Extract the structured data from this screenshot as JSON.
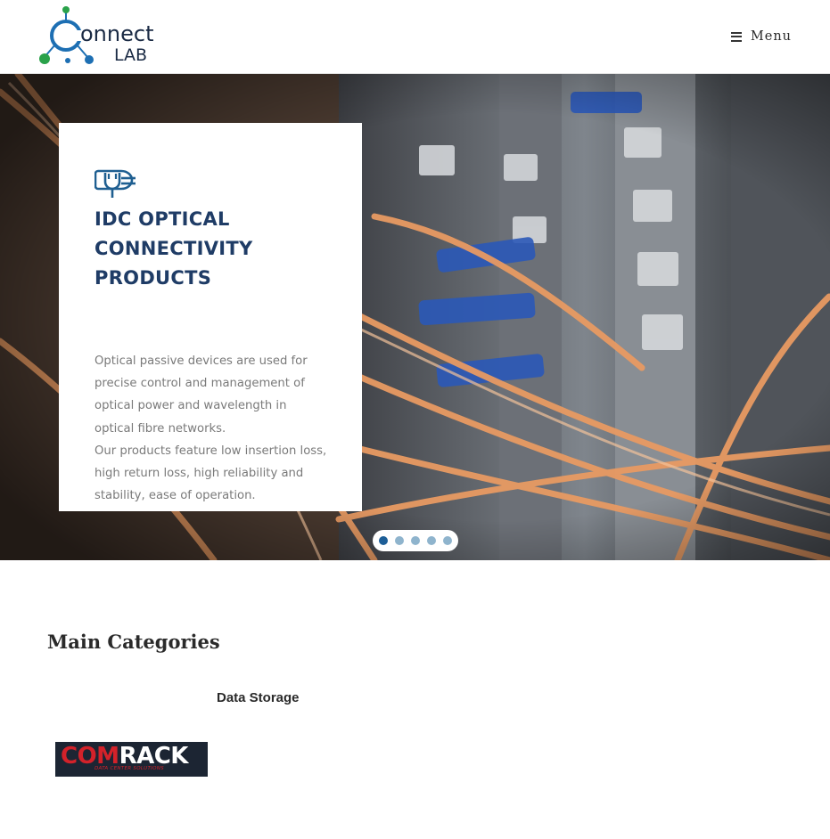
{
  "header": {
    "logo": {
      "text_main": "onnect",
      "text_sub": "LAB",
      "icon": "molecule-c-logo-icon"
    },
    "menu": {
      "label": "Menu",
      "icon": "hamburger-icon"
    }
  },
  "hero": {
    "slide": {
      "icon": "power-plug-icon",
      "title": "IDC OPTICAL CONNECTIVITY PRODUCTS",
      "paragraph_1": "Optical passive devices are used for precise control and management of optical power and wavelength in optical fibre networks.",
      "paragraph_2": "Our products feature low insertion loss, high return loss, high reliability and stability, ease of operation."
    },
    "pagination": {
      "count": 5,
      "active_index": 0
    }
  },
  "categories": {
    "title": "Main Categories",
    "subtitle": "Data Storage",
    "brand_logo": {
      "com": "COM",
      "rack": "RACK",
      "tagline": "DATA CENTER SOLUTIONS"
    }
  },
  "colors": {
    "brand_blue": "#1f3c66",
    "accent_blue": "#1d5e97",
    "dot_inactive": "#8fb4cd",
    "logo_green": "#2aa24a",
    "comrack_red": "#d3222a"
  }
}
